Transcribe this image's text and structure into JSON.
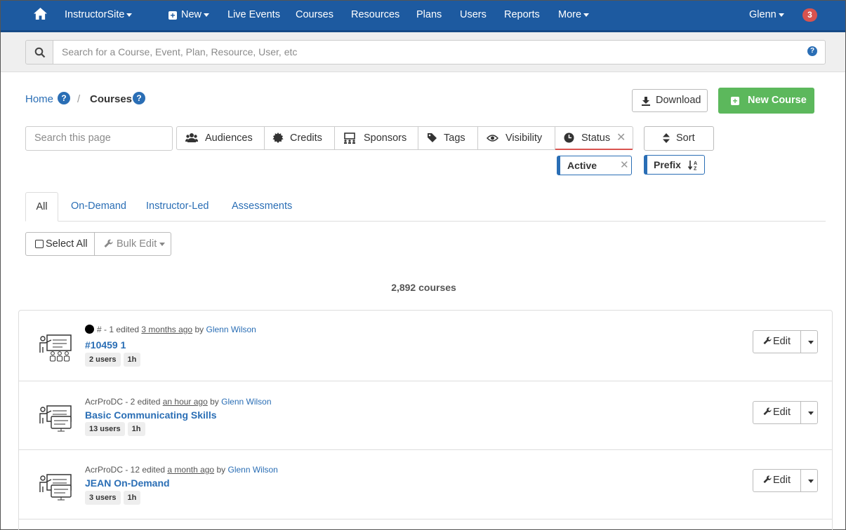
{
  "nav": {
    "brand": "InstructorSite",
    "items": [
      "New",
      "Live Events",
      "Courses",
      "Resources",
      "Plans",
      "Users",
      "Reports",
      "More"
    ],
    "user": "Glenn",
    "notifications": "3"
  },
  "search": {
    "placeholder": "Search for a Course, Event, Plan, Resource, User, etc"
  },
  "breadcrumb": {
    "home": "Home",
    "current": "Courses"
  },
  "actions": {
    "download": "Download",
    "new_course": "New Course"
  },
  "filters": {
    "page_search_placeholder": "Search this page",
    "buttons": [
      "Audiences",
      "Credits",
      "Sponsors",
      "Tags",
      "Visibility",
      "Status"
    ],
    "sort": "Sort",
    "active_chip": "Active",
    "prefix_chip": "Prefix"
  },
  "tabs": [
    "All",
    "On-Demand",
    "Instructor-Led",
    "Assessments"
  ],
  "bulk": {
    "select_all": "Select All",
    "bulk_edit": "Bulk Edit"
  },
  "count_text": "2,892 courses",
  "courses": [
    {
      "prefix": "# - 1 edited",
      "when": "3 months ago",
      "by": "by",
      "author": "Glenn Wilson",
      "title": "#10459 1",
      "users": "2 users",
      "duration": "1h",
      "edit": "Edit"
    },
    {
      "prefix": "AcrProDC - 2 edited",
      "when": "an hour ago",
      "by": "by",
      "author": "Glenn Wilson",
      "title": "Basic Communicating Skills",
      "users": "13 users",
      "duration": "1h",
      "edit": "Edit"
    },
    {
      "prefix": "AcrProDC - 12 edited",
      "when": "a month ago",
      "by": "by",
      "author": "Glenn Wilson",
      "title": "JEAN On-Demand",
      "users": "3 users",
      "duration": "1h",
      "edit": "Edit"
    }
  ]
}
